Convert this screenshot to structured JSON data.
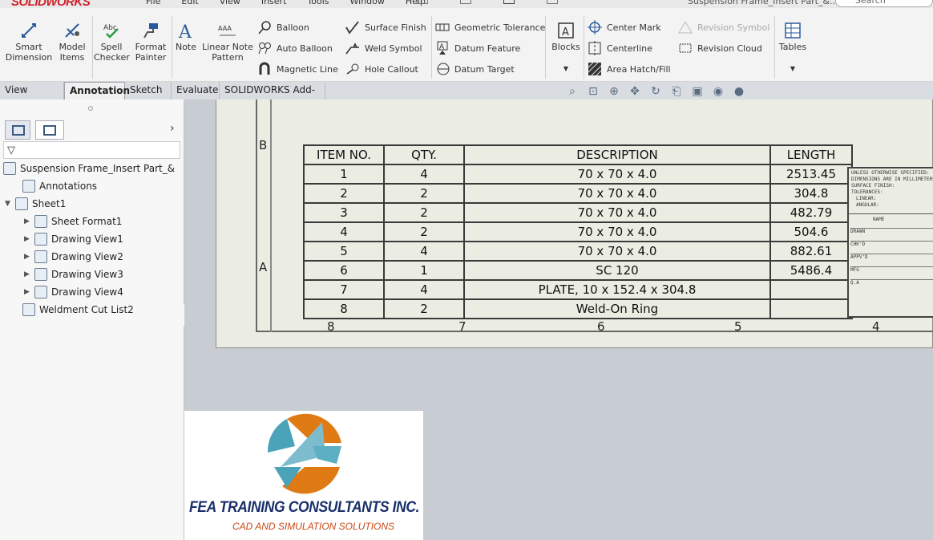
{
  "app": {
    "logo_text": "SOLIDWORKS",
    "document_title": "Suspension Frame_Insert Part_&...",
    "search_placeholder": "Search SOLIDWORKS"
  },
  "menu": [
    "File",
    "Edit",
    "View",
    "Insert",
    "Tools",
    "Window",
    "Help"
  ],
  "ribbon": {
    "smart_dimension": "Smart Dimension",
    "model_items": "Model Items",
    "spell_checker": "Spell Checker",
    "format_painter": "Format Painter",
    "note": "Note",
    "linear_note_pattern": "Linear Note Pattern",
    "balloon": "Balloon",
    "auto_balloon": "Auto Balloon",
    "magnetic_line": "Magnetic Line",
    "surface_finish": "Surface Finish",
    "weld_symbol": "Weld Symbol",
    "hole_callout": "Hole Callout",
    "geometric_tolerance": "Geometric Tolerance",
    "datum_feature": "Datum Feature",
    "datum_target": "Datum Target",
    "blocks": "Blocks",
    "center_mark": "Center Mark",
    "centerline": "Centerline",
    "area_hatch": "Area Hatch/Fill",
    "revision_symbol": "Revision Symbol",
    "revision_cloud": "Revision Cloud",
    "tables": "Tables"
  },
  "tabs": [
    "View Layout",
    "Annotation",
    "Sketch",
    "Evaluate",
    "SOLIDWORKS Add-Ins"
  ],
  "active_tab": "Annotation",
  "tree": {
    "root": "Suspension Frame_Insert Part_&",
    "annotations": "Annotations",
    "sheet": "Sheet1",
    "children": [
      "Sheet Format1",
      "Drawing View1",
      "Drawing View2",
      "Drawing View3",
      "Drawing View4"
    ],
    "weldment": "Weldment Cut List2"
  },
  "bom": {
    "headers": [
      "ITEM NO.",
      "QTY.",
      "DESCRIPTION",
      "LENGTH"
    ],
    "rows": [
      [
        "1",
        "4",
        "70 x 70 x 4.0",
        "2513.45"
      ],
      [
        "2",
        "2",
        "70 x 70 x 4.0",
        "304.8"
      ],
      [
        "3",
        "2",
        "70 x 70 x 4.0",
        "482.79"
      ],
      [
        "4",
        "2",
        "70 x 70 x 4.0",
        "504.6"
      ],
      [
        "5",
        "4",
        "70 x 70 x 4.0",
        "882.61"
      ],
      [
        "6",
        "1",
        "SC 120",
        "5486.4"
      ],
      [
        "7",
        "4",
        "PLATE, 10 x 152.4 x 304.8",
        ""
      ],
      [
        "8",
        "2",
        "Weld-On Ring",
        ""
      ]
    ]
  },
  "zones": {
    "rows": [
      "B",
      "A"
    ],
    "cols": [
      "8",
      "7",
      "6",
      "5",
      "4"
    ]
  },
  "title_block": {
    "notes": [
      "UNLESS OTHERWISE SPECIFIED:",
      "DIMENSIONS ARE IN MILLIMETERS",
      "SURFACE FINISH:",
      "TOLERANCES:",
      "LINEAR:",
      "ANGULAR:"
    ],
    "name_header": "NAME",
    "roles": [
      "DRAWN",
      "CHK'D",
      "APPV'D",
      "MFG",
      "Q.A"
    ]
  },
  "brand": {
    "name": "FEA TRAINING  CONSULTANTS INC.",
    "tagline": "CAD AND SIMULATION SOLUTIONS"
  },
  "colors": {
    "sheet": "#ecede2",
    "canvas": "#c8ccd3",
    "brand_navy": "#1a2f6b",
    "brand_orange": "#e07a14"
  }
}
